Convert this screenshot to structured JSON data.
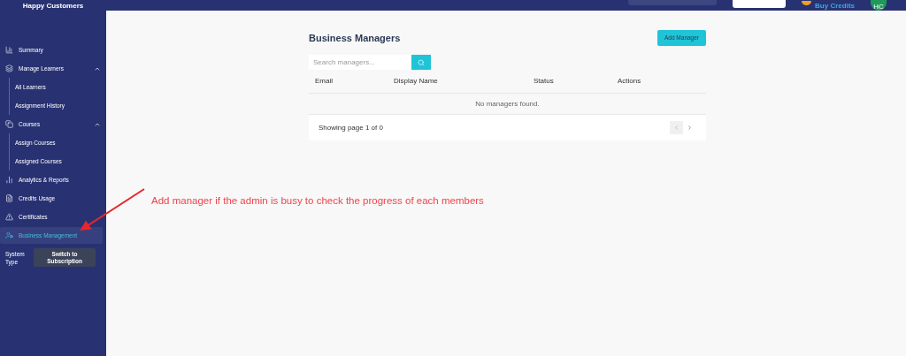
{
  "sidebar": {
    "title": "Happy Customers",
    "items": [
      {
        "label": "Summary",
        "selected": false
      },
      {
        "label": "Manage Learners",
        "selected": false,
        "expanded": true,
        "children": [
          {
            "label": "All Learners",
            "selected": false
          },
          {
            "label": "Assignment History",
            "selected": false
          }
        ]
      },
      {
        "label": "Courses",
        "selected": false,
        "expanded": true,
        "children": [
          {
            "label": "Assign Courses",
            "selected": false
          },
          {
            "label": "Assigned Courses",
            "selected": false
          }
        ]
      },
      {
        "label": "Analytics & Reports",
        "selected": false
      },
      {
        "label": "Credits Usage",
        "selected": false
      },
      {
        "label": "Certificates",
        "selected": false
      },
      {
        "label": "Business Management",
        "selected": true
      }
    ],
    "system_type": {
      "label": "System Type",
      "button": "Switch to Subscription"
    }
  },
  "header": {
    "buy_credits": "Buy Credits",
    "avatar": "HC"
  },
  "page": {
    "title": "Business Managers",
    "add_button": "Add Manager",
    "search": {
      "placeholder": "Search managers..."
    },
    "table": {
      "columns": [
        "Email",
        "Display Name",
        "Status",
        "Actions"
      ],
      "empty": "No managers found."
    },
    "footer": {
      "text": "Showing page 1 of 0"
    }
  },
  "annotation": "Add manager if the admin is busy to check the progress of each members"
}
